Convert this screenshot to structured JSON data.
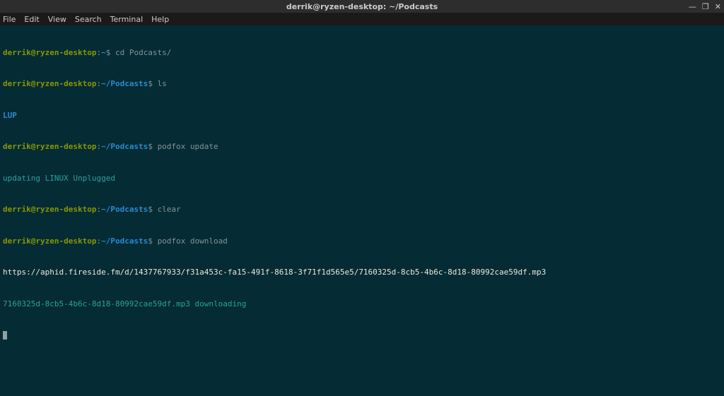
{
  "window": {
    "title": "derrik@ryzen-desktop: ~/Podcasts",
    "controls": {
      "minimize": "—",
      "maximize": "❐",
      "close": "✕"
    }
  },
  "menubar": {
    "items": [
      "File",
      "Edit",
      "View",
      "Search",
      "Terminal",
      "Help"
    ]
  },
  "terminal": {
    "prompt": {
      "user_host": "derrik@ryzen-desktop",
      "colon": ":",
      "home_tilde": "~",
      "path_podcasts": "~/Podcasts",
      "dollar": "$ "
    },
    "lines": [
      {
        "cmd": "cd Podcasts/"
      },
      {
        "cmd": "ls"
      },
      {
        "output_blue": "LUP"
      },
      {
        "cmd": "podfox update"
      },
      {
        "output_green": "updating LINUX Unplugged"
      },
      {
        "cmd": "clear"
      },
      {
        "cmd": "podfox download"
      },
      {
        "output_white": "https://aphid.fireside.fm/d/1437767933/f31a453c-fa15-491f-8618-3f71f1d565e5/7160325d-8cb5-4b6c-8d18-80992cae59df.mp3"
      },
      {
        "output_green2": "7160325d-8cb5-4b6c-8d18-80992cae59df.mp3 downloading"
      }
    ]
  }
}
